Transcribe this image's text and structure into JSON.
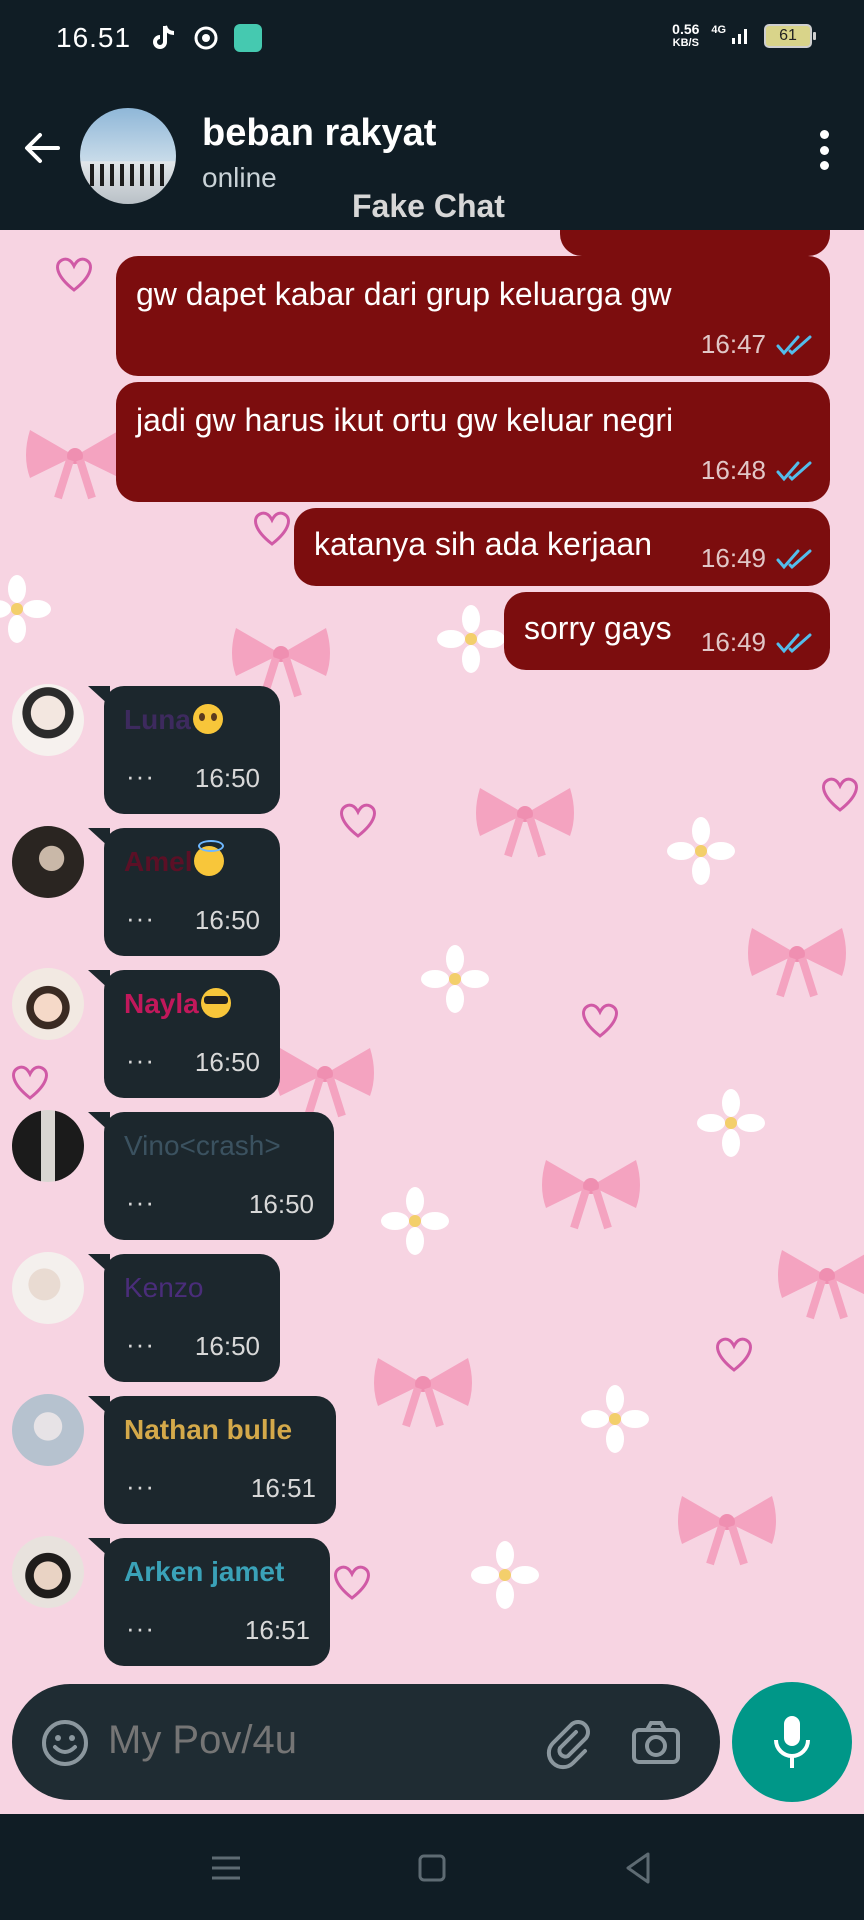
{
  "status_bar": {
    "time": "16.51",
    "net_speed_value": "0.56",
    "net_speed_unit": "KB/S",
    "network": "4G",
    "battery": "61",
    "icons": [
      "tiktok-icon",
      "app-icon",
      "app-icon"
    ]
  },
  "header": {
    "title": "beban rakyat",
    "subtitle": "online",
    "overlay_label": "Fake Chat",
    "icons": [
      "back-arrow-icon",
      "group-avatar",
      "more-vert-icon"
    ]
  },
  "outgoing_messages": [
    {
      "text": "gw dapet kabar dari grup keluarga gw",
      "time": "16:47"
    },
    {
      "text": "jadi gw harus ikut ortu gw keluar negri",
      "time": "16:48"
    },
    {
      "text": "katanya sih ada kerjaan",
      "time": "16:49"
    },
    {
      "text": "sorry gays",
      "time": "16:49"
    }
  ],
  "incoming_messages": [
    {
      "sender": "Luna",
      "emoji": "plead",
      "color": "#3d2a5e",
      "dots": "···",
      "time": "16:50"
    },
    {
      "sender": "Amel",
      "emoji": "halo",
      "color": "#5b1026",
      "dots": "···",
      "time": "16:50"
    },
    {
      "sender": "Nayla",
      "emoji": "cool",
      "color": "#c2185b",
      "dots": "···",
      "time": "16:50"
    },
    {
      "sender": "Vino<crash>",
      "emoji": "",
      "color": "#3b5260",
      "dots": "···",
      "time": "16:50"
    },
    {
      "sender": "Kenzo",
      "emoji": "",
      "color": "#4a2d7a",
      "dots": "···",
      "time": "16:50"
    },
    {
      "sender": "Nathan bulle",
      "emoji": "",
      "color": "#d4a94a",
      "dots": "···",
      "time": "16:51"
    },
    {
      "sender": "Arken jamet",
      "emoji": "",
      "color": "#3aa2b8",
      "dots": "···",
      "time": "16:51"
    }
  ],
  "input": {
    "placeholder": "My Pov/4u",
    "icons": [
      "emoji-icon",
      "attach-icon",
      "camera-icon",
      "mic-icon"
    ]
  },
  "colors": {
    "header_bg": "#101d25",
    "outgoing_bubble": "#7c0d0e",
    "incoming_bubble": "#1c272d",
    "wallpaper": "#f7d4e2",
    "read_ticks": "#53bdeb",
    "mic_button": "#009788"
  }
}
